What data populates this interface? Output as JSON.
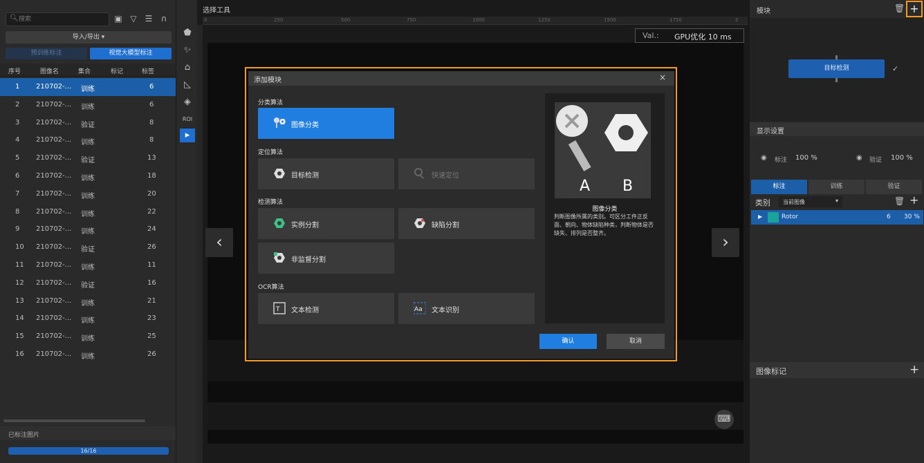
{
  "left": {
    "search_placeholder": "搜索",
    "import_export": "导入/导出 ▾",
    "btn_pretrain": "预训练标注",
    "btn_vision_model": "视觉大模型标注",
    "columns": [
      "序号",
      "图像名",
      "集合",
      "标记",
      "标签"
    ],
    "rows": [
      {
        "idx": "1",
        "name": "210702-...",
        "set": "训练",
        "tag": "6"
      },
      {
        "idx": "2",
        "name": "210702-...",
        "set": "训练",
        "tag": "6"
      },
      {
        "idx": "3",
        "name": "210702-...",
        "set": "验证",
        "tag": "8"
      },
      {
        "idx": "4",
        "name": "210702-...",
        "set": "训练",
        "tag": "8"
      },
      {
        "idx": "5",
        "name": "210702-...",
        "set": "验证",
        "tag": "13"
      },
      {
        "idx": "6",
        "name": "210702-...",
        "set": "训练",
        "tag": "18"
      },
      {
        "idx": "7",
        "name": "210702-...",
        "set": "训练",
        "tag": "20"
      },
      {
        "idx": "8",
        "name": "210702-...",
        "set": "训练",
        "tag": "22"
      },
      {
        "idx": "9",
        "name": "210702-...",
        "set": "训练",
        "tag": "24"
      },
      {
        "idx": "10",
        "name": "210702-...",
        "set": "验证",
        "tag": "26"
      },
      {
        "idx": "11",
        "name": "210702-...",
        "set": "训练",
        "tag": "11"
      },
      {
        "idx": "12",
        "name": "210702-...",
        "set": "验证",
        "tag": "16"
      },
      {
        "idx": "13",
        "name": "210702-...",
        "set": "训练",
        "tag": "21"
      },
      {
        "idx": "14",
        "name": "210702-...",
        "set": "训练",
        "tag": "23"
      },
      {
        "idx": "15",
        "name": "210702-...",
        "set": "训练",
        "tag": "25"
      },
      {
        "idx": "16",
        "name": "210702-...",
        "set": "训练",
        "tag": "26"
      }
    ],
    "labeled_images": "已标注图片",
    "progress": "16/16",
    "progress_fraction": 1.0
  },
  "tools": {
    "roi_label": "ROI"
  },
  "center": {
    "title": "选择工具",
    "ruler_ticks": [
      "0",
      "250",
      "500",
      "750",
      "1000",
      "1250",
      "1500",
      "1750",
      "2"
    ],
    "val_key": "Val.:",
    "val_value": "GPU优化 10 ms"
  },
  "right": {
    "module_title": "模块",
    "module_node": "目标检测",
    "display_settings": "显示设置",
    "label_text": "标注",
    "label_pct": "100 %",
    "verify_text": "验证",
    "verify_pct": "100 %",
    "tabs": [
      "标注",
      "训练",
      "验证"
    ],
    "class_label": "类别",
    "class_filter": "当前图像",
    "class_row": {
      "name": "Rotor",
      "count": "6",
      "pct": "30 %",
      "color": "#1aa39a"
    },
    "image_marks": "图像标记"
  },
  "modal": {
    "title": "添加模块",
    "close": "×",
    "sections": {
      "classify": "分类算法",
      "locate": "定位算法",
      "detect": "检测算法",
      "ocr": "OCR算法"
    },
    "algos": {
      "image_classify": "图像分类",
      "object_detect": "目标检测",
      "fast_locate": "快速定位",
      "instance_seg": "实例分割",
      "defect_seg": "缺陷分割",
      "unsup_seg": "非监督分割",
      "text_detect": "文本检测",
      "text_recog": "文本识别"
    },
    "preview_label_a": "A",
    "preview_label_b": "B",
    "preview_title": "图像分类",
    "preview_desc": "判断图像所属的类别。可区分工件正反面、朝向、物体缺陷种类，判断物体是否缺失、排列是否整齐。",
    "ok": "确认",
    "cancel": "取消"
  },
  "colors": {
    "accent": "#1f7ee0",
    "highlight": "#f59a23"
  }
}
